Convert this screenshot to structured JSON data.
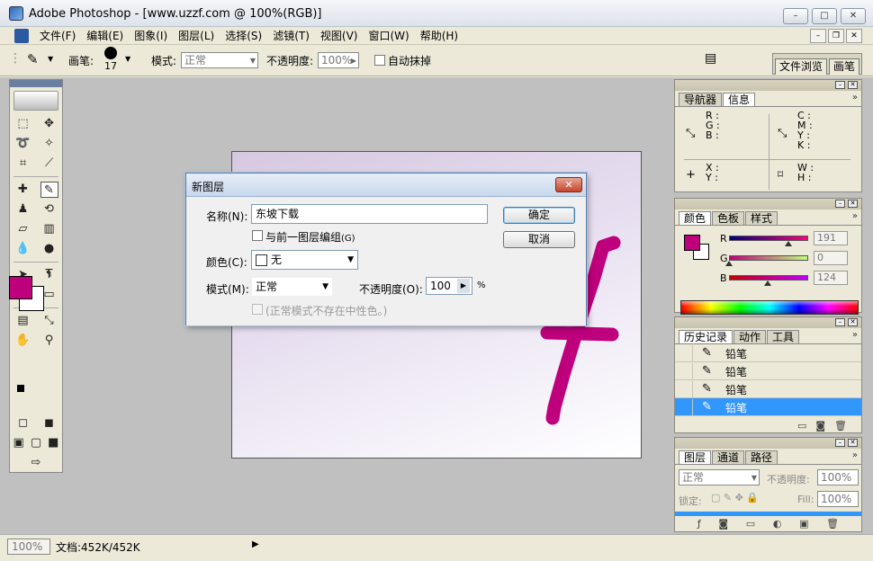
{
  "window": {
    "title": "Adobe Photoshop - [www.uzzf.com @ 100%(RGB)]",
    "minimize": "–",
    "maximize": "□",
    "close": "✕"
  },
  "menu": {
    "items": [
      "文件(F)",
      "编辑(E)",
      "图象(I)",
      "图层(L)",
      "选择(S)",
      "滤镜(T)",
      "视图(V)",
      "窗口(W)",
      "帮助(H)"
    ],
    "doc_minimize": "–",
    "doc_restore": "❐",
    "doc_close": "✕"
  },
  "options": {
    "brush_label": "画笔:",
    "brush_size": "17",
    "mode_label": "模式:",
    "mode_value": "正常",
    "opacity_label": "不透明度:",
    "opacity_value": "100%",
    "auto_erase_label": "自动抹掉",
    "tabs": [
      "文件浏览",
      "画笔"
    ]
  },
  "navigator": {
    "tabs": [
      "导航器",
      "信息"
    ],
    "rgb_labels": [
      "R :",
      "G :",
      "B :"
    ],
    "cmyk_labels": [
      "C :",
      "M :",
      "Y :",
      "K :"
    ],
    "xy_labels": [
      "X :",
      "Y :"
    ],
    "wh_labels": [
      "W :",
      "H :"
    ]
  },
  "color_panel": {
    "tabs": [
      "颜色",
      "色板",
      "样式"
    ],
    "r_label": "R",
    "g_label": "G",
    "b_label": "B",
    "r_value": "191",
    "g_value": "0",
    "b_value": "124",
    "r_level": 0.749,
    "g_level": 0.0,
    "b_level": 0.486,
    "foreground": "#bf007c",
    "background": "#ffffff"
  },
  "history_panel": {
    "tabs": [
      "历史记录",
      "动作",
      "工具"
    ],
    "items": [
      "铅笔",
      "铅笔",
      "铅笔",
      "铅笔"
    ],
    "selected_index": 3
  },
  "layers_panel": {
    "tabs": [
      "图层",
      "通道",
      "路径"
    ],
    "blend_mode": "正常",
    "opacity_label": "不透明度:",
    "opacity_value": "100%",
    "lock_label": "锁定:",
    "fill_label": "Fill:",
    "fill_value": "100%"
  },
  "dialog": {
    "title": "新图层",
    "name_label": "名称(N):",
    "name_value": "东坡下载",
    "group_label": "与前一图层编组",
    "group_key": "(G)",
    "color_label": "颜色(C):",
    "color_value": "无",
    "mode_label": "模式(M):",
    "mode_value": "正常",
    "opacity_label": "不透明度(O):",
    "opacity_value": "100",
    "opacity_unit": "%",
    "neutral_label": "(正常模式不存在中性色。)",
    "ok_label": "确定",
    "cancel_label": "取消",
    "close": "✕"
  },
  "status": {
    "zoom": "100%",
    "doc_info": "文档:452K/452K"
  },
  "colors": {
    "stroke": "#bf007c",
    "selection": "#3297fd"
  }
}
